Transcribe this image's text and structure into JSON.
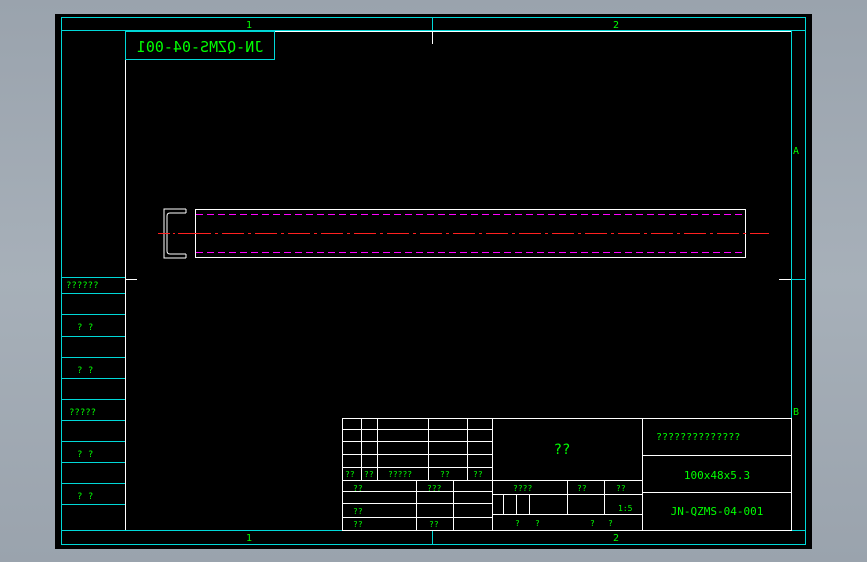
{
  "drawing_number_mirrored": "JN-QZMS-04-001",
  "zone_labels": {
    "top_1": "1",
    "top_2": "2",
    "bottom_1": "1",
    "bottom_2": "2",
    "right_a": "A",
    "right_b": "B"
  },
  "left_strip": [
    "??????",
    "? ?",
    "? ?",
    "?????",
    "? ?",
    "? ?"
  ],
  "title_block": {
    "company": "??",
    "name": "??????????????",
    "spec": "100x48x5.3",
    "drawing_no": "JN-QZMS-04-001",
    "scale": "1:5",
    "rev_headers": [
      "??",
      "??",
      "?????",
      "??",
      "??"
    ],
    "rev_sign_rows": [
      {
        "label": "??",
        "mid": "???"
      },
      {
        "label": "??",
        "mid": ""
      },
      {
        "label": "??",
        "mid": "??"
      }
    ],
    "stage_headers": [
      "????",
      "??",
      "??"
    ],
    "sheet_labels": [
      "?",
      "?",
      "?",
      "?"
    ]
  },
  "colors": {
    "frame": "#00d8d8",
    "text": "#00ff00",
    "outline": "#ffffff",
    "hidden_line": "#ff00ff",
    "center_line": "#ff2020"
  }
}
